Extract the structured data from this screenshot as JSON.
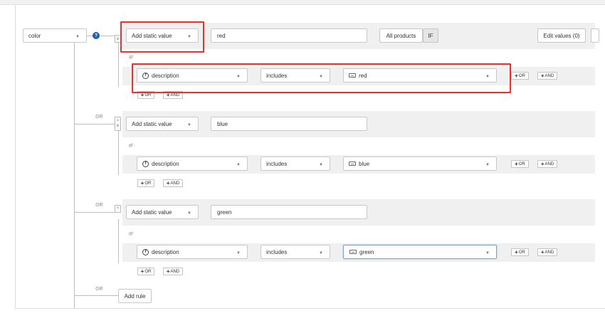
{
  "attribute": {
    "value": "color"
  },
  "rules": [
    {
      "or_label": "",
      "value_type": "Add static value",
      "value": "red",
      "condition_if_label": "IF",
      "condition": {
        "field": "description",
        "operator": "includes",
        "value": "red"
      },
      "or_button": "OR",
      "and_button": "AND"
    },
    {
      "or_label": "OR",
      "value_type": "Add static value",
      "value": "blue",
      "condition_if_label": "IF",
      "condition": {
        "field": "description",
        "operator": "includes",
        "value": "blue"
      },
      "or_button": "OR",
      "and_button": "AND"
    },
    {
      "or_label": "OR",
      "value_type": "Add static value",
      "value": "green",
      "condition_if_label": "IF",
      "condition": {
        "field": "description",
        "operator": "includes",
        "value": "green"
      },
      "or_button": "OR",
      "and_button": "AND"
    }
  ],
  "header": {
    "all_products": "All products",
    "if_toggle": "IF",
    "edit_values": "Edit values (0)"
  },
  "add_rule": {
    "or_label": "OR",
    "label": "Add rule"
  },
  "icons": {
    "help": "?",
    "caret": "▼",
    "up": "^",
    "down": "v",
    "plus": "+"
  },
  "colors": {
    "highlight": "#e8312a",
    "band": "#f0f0f0",
    "help_icon": "#1f5da8"
  }
}
